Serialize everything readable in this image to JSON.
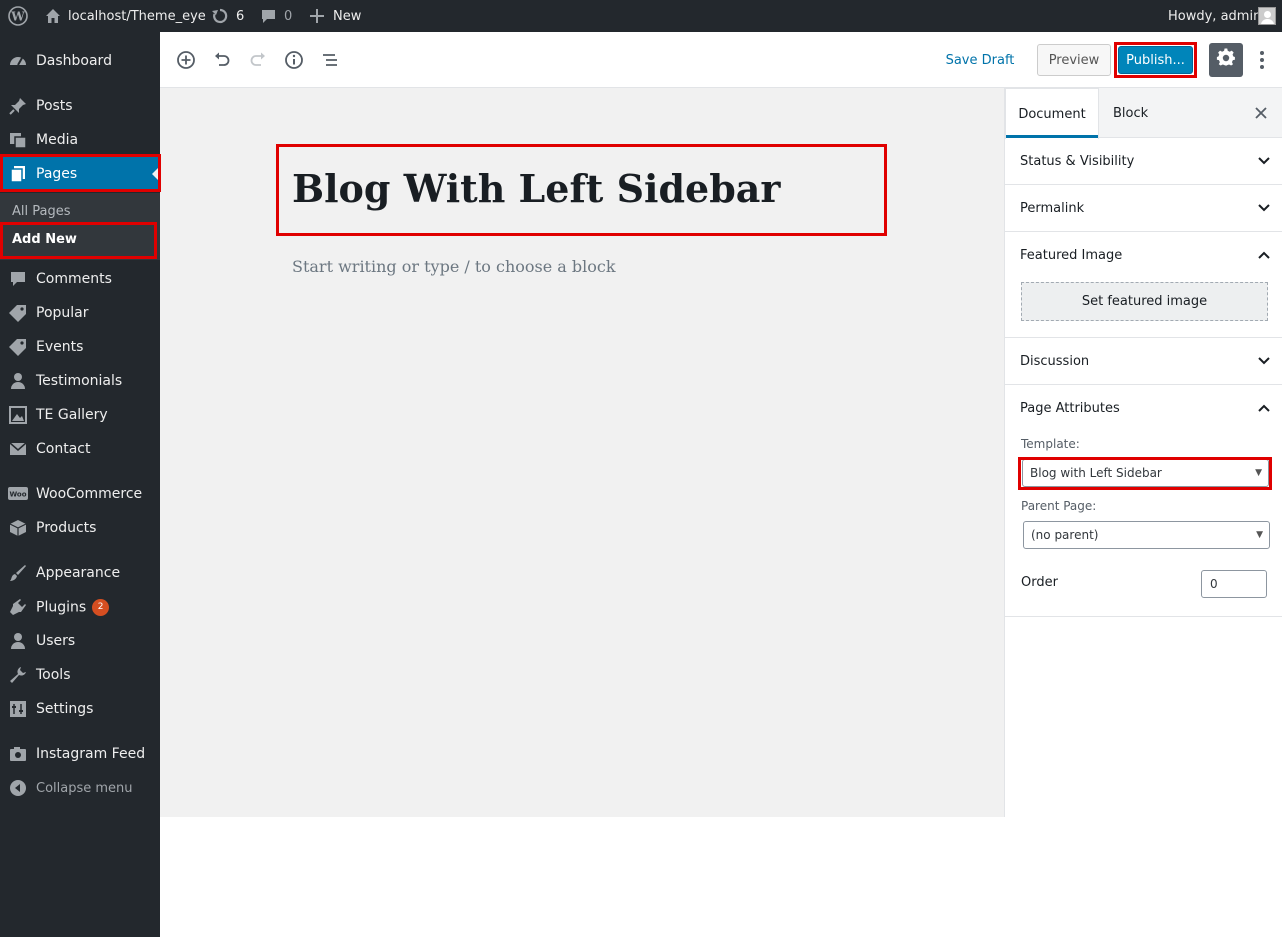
{
  "adminbar": {
    "site_name": "localhost/Theme_eye",
    "updates_count": "6",
    "comments_count": "0",
    "new_label": "New",
    "greeting": "Howdy, admin"
  },
  "sidebar": {
    "items": [
      {
        "label": "Dashboard",
        "icon": "dashboard-icon"
      },
      {
        "label": "Posts",
        "icon": "pin-icon"
      },
      {
        "label": "Media",
        "icon": "media-icon"
      },
      {
        "label": "Pages",
        "icon": "pages-icon"
      },
      {
        "label": "Comments",
        "icon": "comment-icon"
      },
      {
        "label": "Popular",
        "icon": "tag-icon"
      },
      {
        "label": "Events",
        "icon": "tag-icon"
      },
      {
        "label": "Testimonials",
        "icon": "user-icon"
      },
      {
        "label": "TE Gallery",
        "icon": "gallery-icon"
      },
      {
        "label": "Contact",
        "icon": "mail-icon"
      },
      {
        "label": "WooCommerce",
        "icon": "woo-icon"
      },
      {
        "label": "Products",
        "icon": "box-icon"
      },
      {
        "label": "Appearance",
        "icon": "brush-icon"
      },
      {
        "label": "Plugins",
        "icon": "plugin-icon",
        "badge": "2"
      },
      {
        "label": "Users",
        "icon": "user-icon"
      },
      {
        "label": "Tools",
        "icon": "wrench-icon"
      },
      {
        "label": "Settings",
        "icon": "settings-icon"
      },
      {
        "label": "Instagram Feed",
        "icon": "camera-icon"
      },
      {
        "label": "Collapse menu",
        "icon": "collapse-icon"
      }
    ],
    "submenu": {
      "all_pages": "All Pages",
      "add_new": "Add New"
    }
  },
  "toolbar": {
    "save_draft": "Save Draft",
    "preview": "Preview",
    "publish": "Publish..."
  },
  "editor": {
    "title": "Blog With Left Sidebar",
    "placeholder": "Start writing or type / to choose a block"
  },
  "panel": {
    "tabs": [
      "Document",
      "Block"
    ],
    "sections": {
      "status": "Status & Visibility",
      "permalink": "Permalink",
      "featured": "Featured Image",
      "set_featured": "Set featured image",
      "discussion": "Discussion",
      "attributes": "Page Attributes"
    },
    "template_label": "Template:",
    "template_value": "Blog with Left Sidebar",
    "parent_label": "Parent Page:",
    "parent_value": "(no parent)",
    "order_label": "Order",
    "order_value": "0"
  },
  "colors": {
    "accent": "#0073aa",
    "highlight": "#e00000",
    "sidebar_bg": "#23282d"
  }
}
